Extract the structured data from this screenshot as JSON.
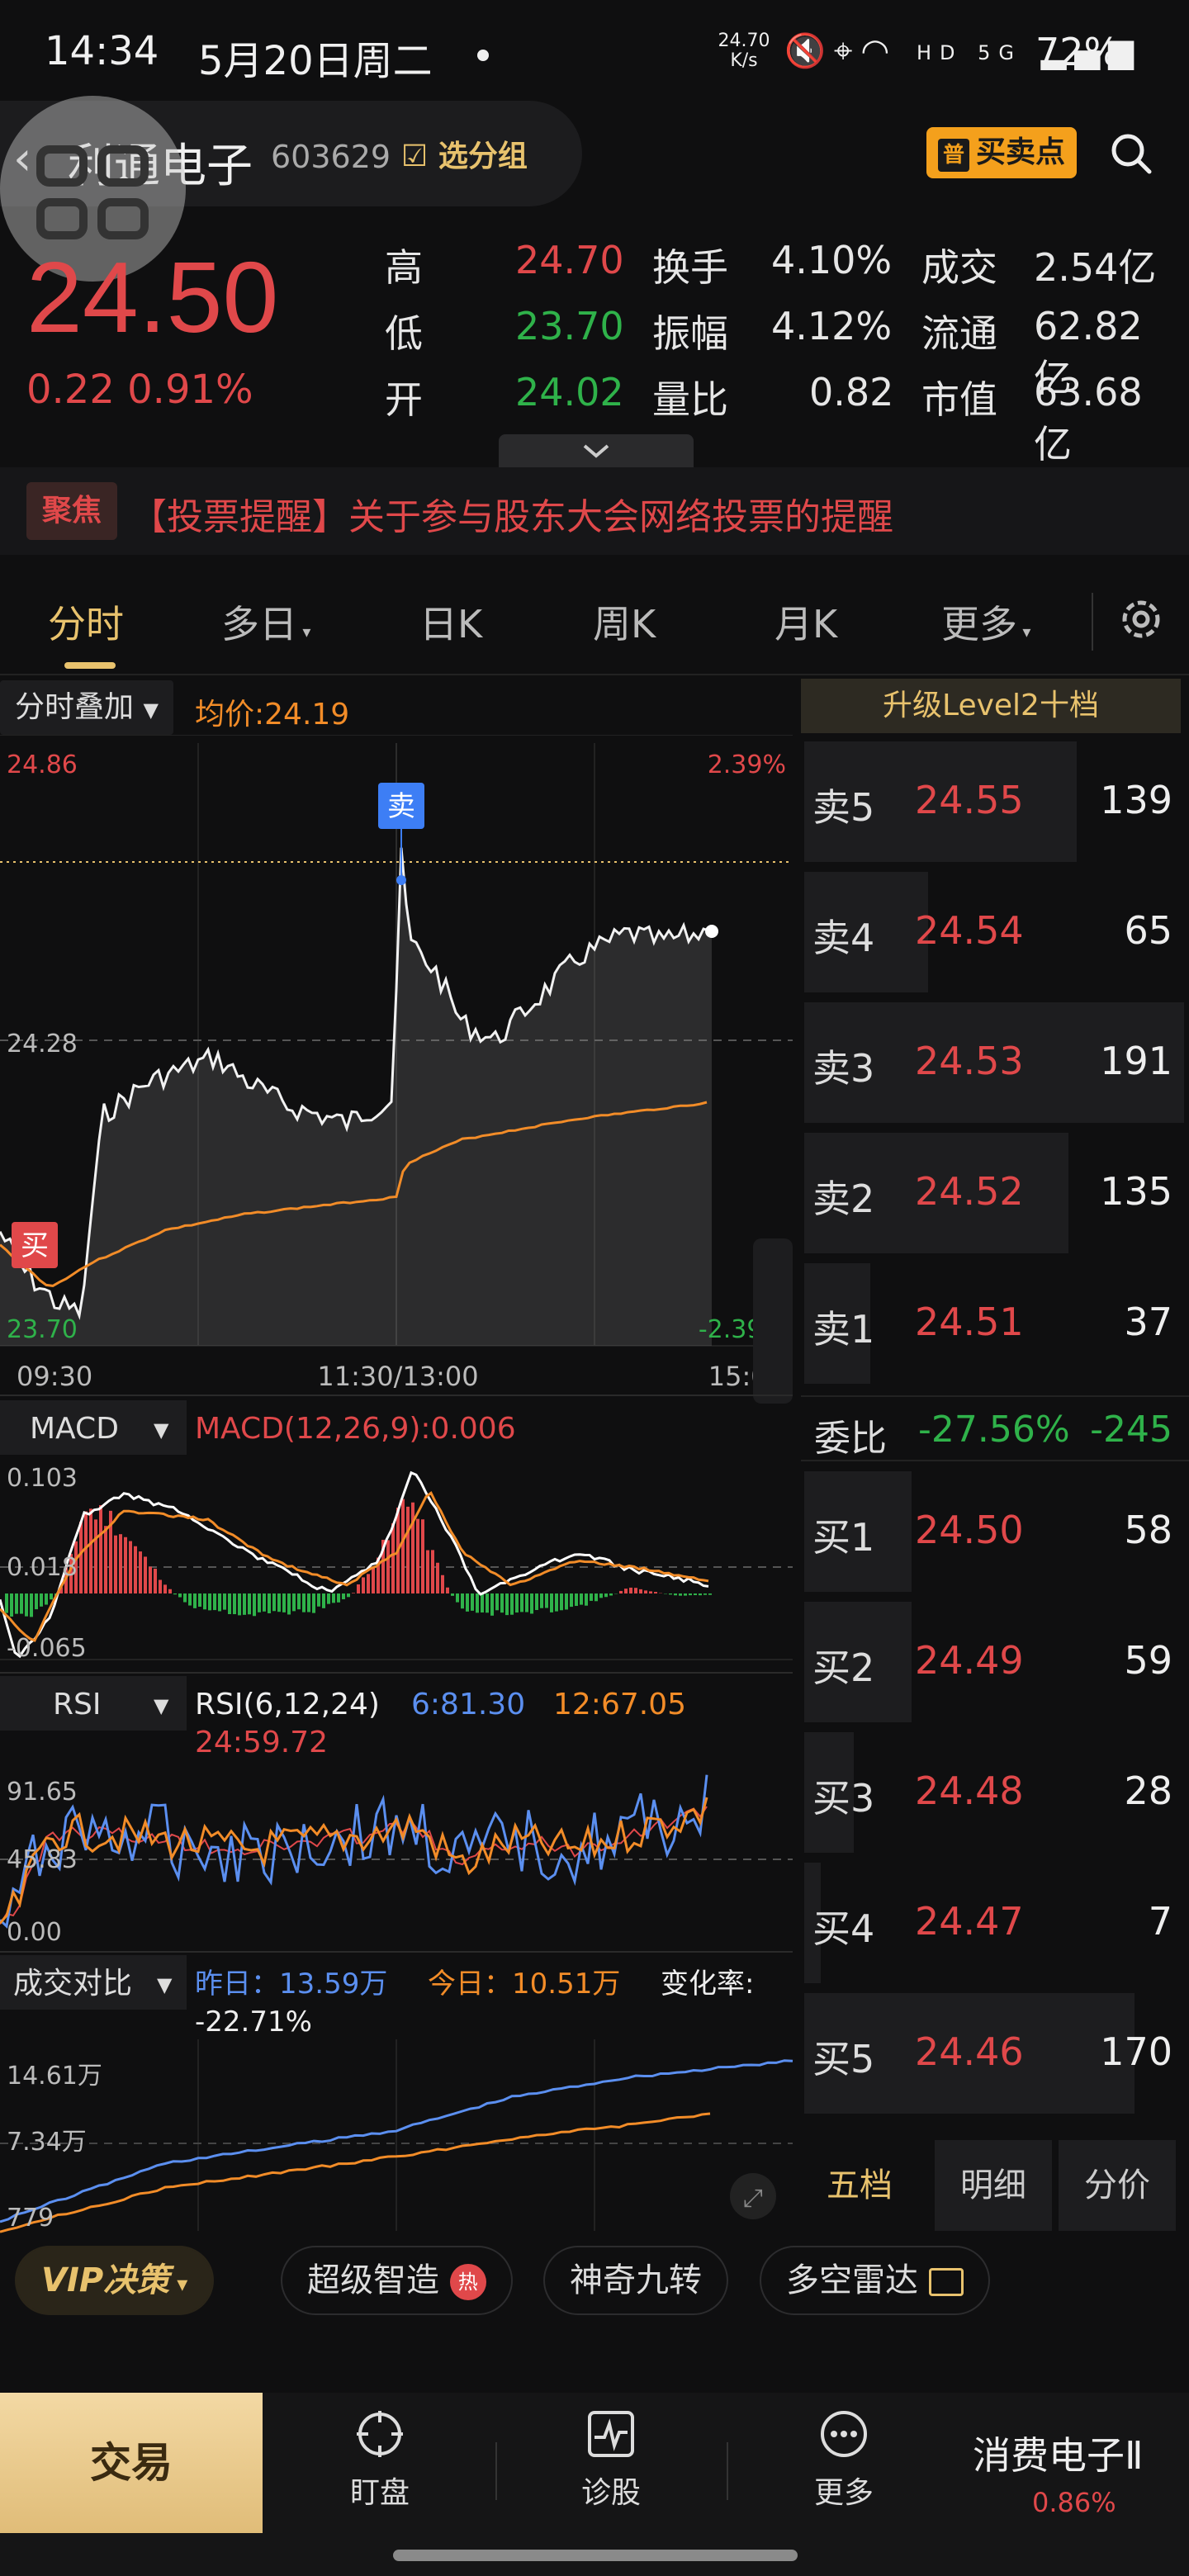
{
  "status_bar": {
    "time": "14:34",
    "date": "5月20日周二",
    "net_speed_value": "24.70",
    "net_speed_unit": "K/s",
    "network": "HD 5G",
    "battery": "72%"
  },
  "header": {
    "stock_name": "利通电子",
    "stock_code": "603629",
    "group_label": "选分组",
    "buy_sell_tag": "普",
    "buy_sell_label": "买卖点"
  },
  "quote": {
    "price": "24.50",
    "change": "0.22",
    "change_pct": "0.91%",
    "rows": [
      {
        "l1": "高",
        "v1": "24.70",
        "l2": "换手",
        "v2": "4.10%",
        "l3": "成交",
        "v3": "2.54亿"
      },
      {
        "l1": "低",
        "v1": "23.70",
        "l2": "振幅",
        "v2": "4.12%",
        "l3": "流通",
        "v3": "62.82亿"
      },
      {
        "l1": "开",
        "v1": "24.02",
        "l2": "量比",
        "v2": "0.82",
        "l3": "市值",
        "v3": "63.68亿"
      }
    ]
  },
  "news": {
    "badge": "聚焦",
    "text": "【投票提醒】关于参与股东大会网络投票的提醒"
  },
  "tabs": [
    "分时",
    "多日",
    "日K",
    "周K",
    "月K",
    "更多"
  ],
  "intraday": {
    "overlay_label": "分时叠加",
    "avg_label": "均价:24.19",
    "y_top": "24.86",
    "y_mid": "24.28",
    "y_bottom": "23.70",
    "pct_top": "2.39%",
    "pct_bottom": "-2.39%",
    "x_start": "09:30",
    "x_mid": "11:30/13:00",
    "x_end": "15:00",
    "sell_marker": "卖",
    "buy_marker": "买"
  },
  "macd": {
    "label": "MACD",
    "params": "MACD(12,26,9):0.006",
    "y_top": "0.103",
    "y_mid": "0.018",
    "y_bottom": "-0.065"
  },
  "rsi": {
    "label": "RSI",
    "params": "RSI(6,12,24)",
    "rsi6": "6:81.30",
    "rsi12": "12:67.05",
    "rsi24": "24:59.72",
    "y_top": "91.65",
    "y_mid": "45.83",
    "y_bottom": "0.00"
  },
  "volume_compare": {
    "label": "成交对比",
    "yesterday": "昨日：13.59万",
    "today": "今日：10.51万",
    "change_label": "变化率:",
    "change_value": "-22.71%",
    "y_top": "14.61万",
    "y_mid": "7.34万",
    "y_bottom": "779"
  },
  "order_book": {
    "level2_label": "升级Level2十档",
    "asks": [
      {
        "label": "卖5",
        "price": "24.55",
        "volume": "139"
      },
      {
        "label": "卖4",
        "price": "24.54",
        "volume": "65"
      },
      {
        "label": "卖3",
        "price": "24.53",
        "volume": "191"
      },
      {
        "label": "卖2",
        "price": "24.52",
        "volume": "135"
      },
      {
        "label": "卖1",
        "price": "24.51",
        "volume": "37"
      }
    ],
    "ratio_label": "委比",
    "ratio_value": "-27.56%",
    "ratio_diff": "-245",
    "bids": [
      {
        "label": "买1",
        "price": "24.50",
        "volume": "58"
      },
      {
        "label": "买2",
        "price": "24.49",
        "volume": "59"
      },
      {
        "label": "买3",
        "price": "24.48",
        "volume": "28"
      },
      {
        "label": "买4",
        "price": "24.47",
        "volume": "7"
      },
      {
        "label": "买5",
        "price": "24.46",
        "volume": "170"
      }
    ],
    "tabs": [
      "五档",
      "明细",
      "分价"
    ]
  },
  "features": {
    "vip": "VIP决策",
    "f1": "超级智造",
    "hot": "热",
    "f2": "神奇九转",
    "f3": "多空雷达"
  },
  "bottom_nav": {
    "trade": "交易",
    "watch": "盯盘",
    "diagnose": "诊股",
    "more": "更多",
    "sector_name": "消费电子Ⅱ",
    "sector_pct": "0.86%"
  },
  "colors": {
    "up": "#e0484a",
    "down": "#2fb24a",
    "gold": "#e8c26d",
    "avg_line": "#f28c28",
    "blue_line": "#5b8ff0"
  }
}
